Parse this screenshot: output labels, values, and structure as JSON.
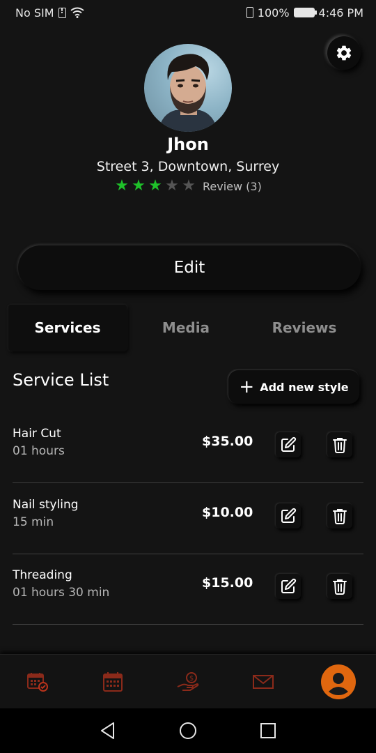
{
  "status_bar": {
    "carrier": "No SIM",
    "battery": "100%",
    "time": "4:46 PM"
  },
  "profile": {
    "name": "Jhon",
    "address": "Street 3, Downtown, Surrey",
    "rating": 3,
    "rating_max": 5,
    "review_label": "Review (3)"
  },
  "actions": {
    "edit_label": "Edit"
  },
  "tabs": [
    {
      "label": "Services",
      "active": true
    },
    {
      "label": "Media",
      "active": false
    },
    {
      "label": "Reviews",
      "active": false
    }
  ],
  "service_list": {
    "title": "Service List",
    "add_label": "Add new style",
    "items": [
      {
        "name": "Hair Cut",
        "duration": "01 hours",
        "price": "$35.00"
      },
      {
        "name": "Nail styling",
        "duration": "15 min",
        "price": "$10.00"
      },
      {
        "name": "Threading",
        "duration": "01 hours 30 min",
        "price": "$15.00"
      }
    ]
  },
  "bottom_nav": {
    "icons": [
      "calendar-check-icon",
      "calendar-icon",
      "hand-money-icon",
      "mail-icon",
      "profile-icon"
    ]
  },
  "colors": {
    "accent": "#e0670f",
    "nav_icon": "#b8331b",
    "star_on": "#1fc12a",
    "background": "#141414"
  }
}
